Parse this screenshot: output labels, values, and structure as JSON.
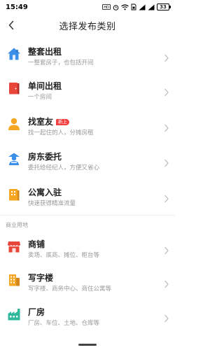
{
  "status_bar": {
    "time": "15:49",
    "battery": "33"
  },
  "nav": {
    "title": "选择发布类别"
  },
  "items": [
    {
      "title": "整套出租",
      "subtitle": "一整套房子，也包括开间",
      "icon": "house-icon",
      "color": "#3b8fe8"
    },
    {
      "title": "单间出租",
      "subtitle": "一个房间",
      "icon": "door-icon",
      "color": "#e8453b"
    },
    {
      "title": "找室友",
      "badge": "新上",
      "subtitle": "找一起住的人，分摊房租",
      "icon": "person-icon",
      "color": "#f5a623"
    },
    {
      "title": "房东委托",
      "subtitle": "委托给经纪人，方便又省心",
      "icon": "agent-icon",
      "color": "#3b8fe8"
    },
    {
      "title": "公寓入驻",
      "subtitle": "快速获得精准流量",
      "icon": "apartment-icon",
      "color": "#f5a623"
    },
    {
      "title": "商铺",
      "subtitle": "卖场、底商、摊位、柜台等",
      "icon": "shop-icon",
      "color": "#e8453b"
    },
    {
      "title": "写字楼",
      "subtitle": "写字楼、商务中心、商住公寓等",
      "icon": "office-building-icon",
      "color": "#f5a623"
    },
    {
      "title": "厂房",
      "subtitle": "厂房、车位、土地、仓库等",
      "icon": "factory-icon",
      "color": "#2fb89a"
    }
  ],
  "section": {
    "commercial_label": "商业用地"
  }
}
